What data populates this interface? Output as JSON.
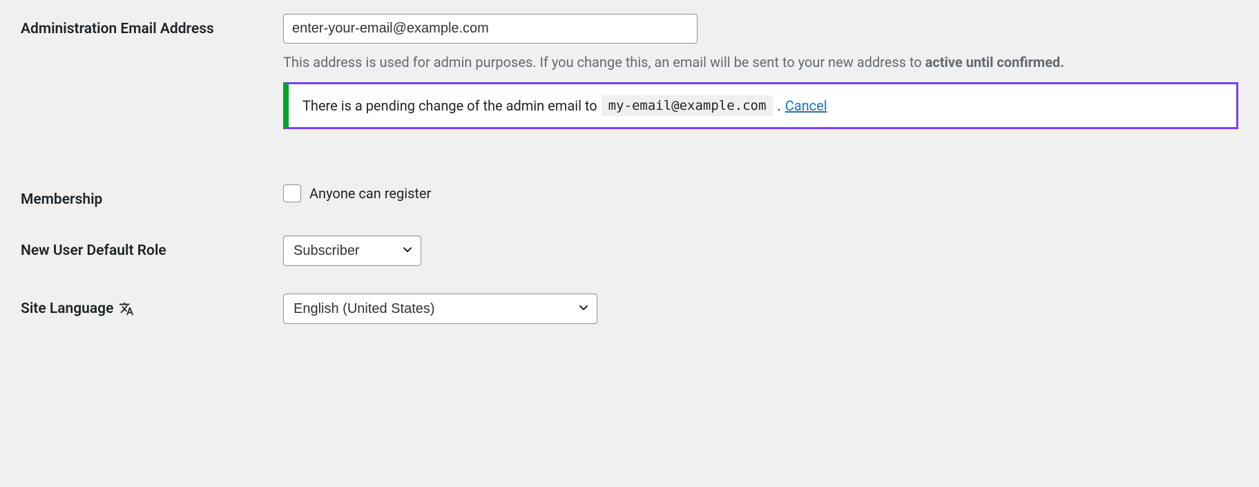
{
  "adminEmail": {
    "label": "Administration Email Address",
    "value": "enter-your-email@example.com",
    "descriptionPart1": "This address is used for admin purposes. If you change this, an email will be sent to your new address to ",
    "descriptionStrong": "active until confirmed.",
    "pendingText": "There is a pending change of the admin email to ",
    "pendingEmail": "my-email@example.com",
    "pendingDot": ". ",
    "cancelLink": "Cancel"
  },
  "membership": {
    "label": "Membership",
    "checkboxLabel": "Anyone can register"
  },
  "defaultRole": {
    "label": "New User Default Role",
    "selected": "Subscriber"
  },
  "siteLanguage": {
    "label": "Site Language",
    "selected": "English (United States)"
  }
}
